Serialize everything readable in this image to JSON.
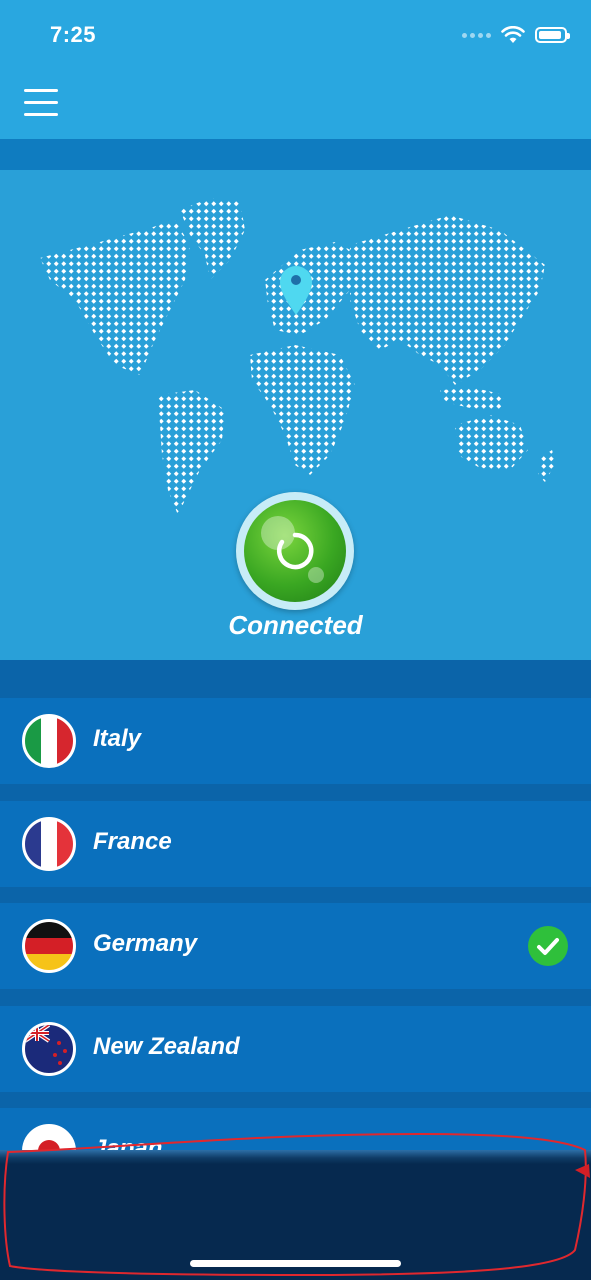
{
  "status_bar": {
    "time": "7:25"
  },
  "header": {
    "menu_icon": "hamburger-menu-icon"
  },
  "connection": {
    "status_label": "Connected",
    "button_icon": "power-icon",
    "accent_color": "#3aa722"
  },
  "map": {
    "pin_icon": "location-pin-icon",
    "pin_color": "#4fd8f0"
  },
  "countries": [
    {
      "name": "Italy",
      "flag": "italy-flag-icon",
      "selected": false
    },
    {
      "name": "France",
      "flag": "france-flag-icon",
      "selected": false
    },
    {
      "name": "Germany",
      "flag": "germany-flag-icon",
      "selected": true
    },
    {
      "name": "New Zealand",
      "flag": "new-zealand-flag-icon",
      "selected": false
    },
    {
      "name": "Japan",
      "flag": "japan-flag-icon",
      "selected": false
    }
  ],
  "selected_icon": "checkmark-icon"
}
